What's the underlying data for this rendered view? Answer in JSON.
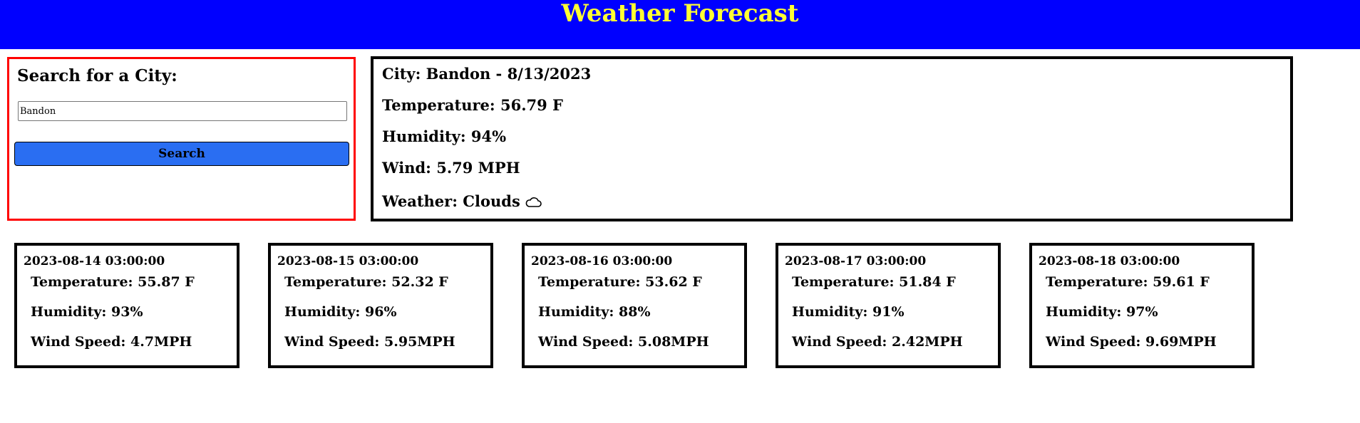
{
  "header": {
    "title": "Weather Forecast",
    "background_color": "#0000ff",
    "title_color": "#ffff33"
  },
  "search": {
    "title": "Search for a City:",
    "input_value": "Bandon",
    "button_label": "Search",
    "button_color": "#2a6ef2",
    "border_color": "#ff0000"
  },
  "current": {
    "city": "City: Bandon - 8/13/2023",
    "temperature": "Temperature: 56.79 F",
    "humidity": "Humidity: 94%",
    "wind": "Wind: 5.79 MPH",
    "weather": "Weather: Clouds",
    "weather_icon": "cloud-icon"
  },
  "forecast": [
    {
      "date": "2023-08-14 03:00:00",
      "temperature": "Temperature: 55.87 F",
      "humidity": "Humidity: 93%",
      "wind": "Wind Speed: 4.7MPH"
    },
    {
      "date": "2023-08-15 03:00:00",
      "temperature": "Temperature: 52.32 F",
      "humidity": "Humidity: 96%",
      "wind": "Wind Speed: 5.95MPH"
    },
    {
      "date": "2023-08-16 03:00:00",
      "temperature": "Temperature: 53.62 F",
      "humidity": "Humidity: 88%",
      "wind": "Wind Speed: 5.08MPH"
    },
    {
      "date": "2023-08-17 03:00:00",
      "temperature": "Temperature: 51.84 F",
      "humidity": "Humidity: 91%",
      "wind": "Wind Speed: 2.42MPH"
    },
    {
      "date": "2023-08-18 03:00:00",
      "temperature": "Temperature: 59.61 F",
      "humidity": "Humidity: 97%",
      "wind": "Wind Speed: 9.69MPH"
    }
  ]
}
